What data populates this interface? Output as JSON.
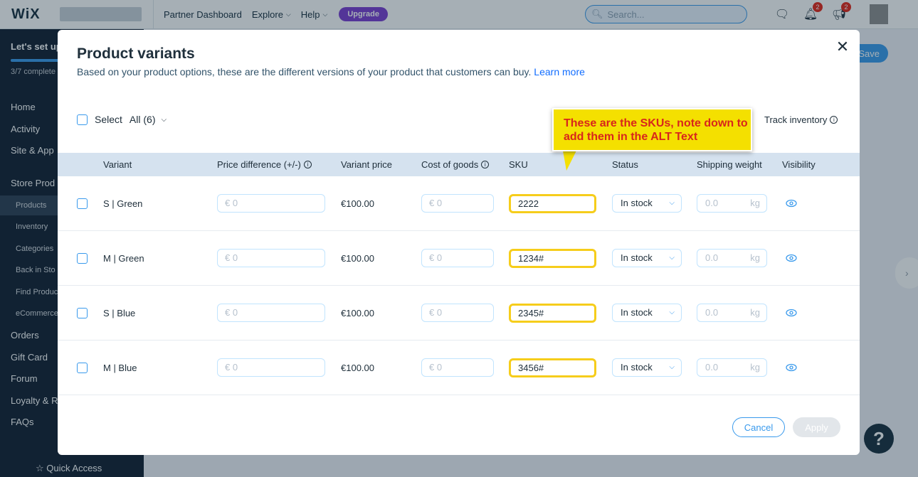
{
  "topbar": {
    "logo": "WiX",
    "links": [
      "Partner Dashboard",
      "Explore",
      "Help"
    ],
    "upgrade_label": "Upgrade",
    "search_placeholder": "Search...",
    "notification_count": "2",
    "messages_count": "2"
  },
  "sidebar": {
    "setup_title": "Let's set up",
    "setup_progress": "3/7 complete",
    "setup_progress_fraction": 0.43,
    "items": [
      "Home",
      "Activity",
      "Site & App",
      "Store Prod",
      "Orders",
      "Gift Card",
      "Forum",
      "Loyalty & R",
      "FAQs"
    ],
    "sub_items": [
      "Products",
      "Inventory",
      "Categories",
      "Back in Sto",
      "Find Produc",
      "eCommerce"
    ],
    "quick_access": "Quick Access"
  },
  "background": {
    "save_label": "Save",
    "help_label": "?"
  },
  "modal": {
    "title": "Product variants",
    "subtitle": "Based on your product options, these are the different versions of your product that customers can buy.",
    "learn_more": "Learn more",
    "select_label": "Select",
    "select_filter": "All (6)",
    "track_inventory": "Track inventory",
    "columns": {
      "variant": "Variant",
      "price_diff": "Price difference (+/-)",
      "variant_price": "Variant price",
      "cost_of_goods": "Cost of goods",
      "sku": "SKU",
      "status": "Status",
      "shipping_weight": "Shipping weight",
      "visibility": "Visibility"
    },
    "rows": [
      {
        "variant": "S | Green",
        "price_diff": "€ 0",
        "price": "€100.00",
        "cost": "€ 0",
        "sku": "2222",
        "status": "In stock",
        "weight": "0.0",
        "unit": "kg"
      },
      {
        "variant": "M | Green",
        "price_diff": "€ 0",
        "price": "€100.00",
        "cost": "€ 0",
        "sku": "1234#",
        "status": "In stock",
        "weight": "0.0",
        "unit": "kg"
      },
      {
        "variant": "S | Blue",
        "price_diff": "€ 0",
        "price": "€100.00",
        "cost": "€ 0",
        "sku": "2345#",
        "status": "In stock",
        "weight": "0.0",
        "unit": "kg"
      },
      {
        "variant": "M | Blue",
        "price_diff": "€ 0",
        "price": "€100.00",
        "cost": "€ 0",
        "sku": "3456#",
        "status": "In stock",
        "weight": "0.0",
        "unit": "kg"
      }
    ],
    "cancel_label": "Cancel",
    "apply_label": "Apply"
  },
  "callout": {
    "text": "These are the SKUs, note down to add them in the ALT Text"
  },
  "colors": {
    "accent": "#3899ec",
    "upgrade": "#7a3bd1",
    "callout_bg": "#f4e000",
    "callout_text": "#d8261c",
    "sku_highlight": "#f6cd1b",
    "sidebar_bg": "#0f1c2e"
  },
  "icons": [
    "search-icon",
    "chat-icon",
    "bell-icon",
    "megaphone-icon",
    "close-icon",
    "chevron-down-icon",
    "info-icon",
    "eye-icon",
    "chevron-right-icon",
    "star-icon"
  ]
}
